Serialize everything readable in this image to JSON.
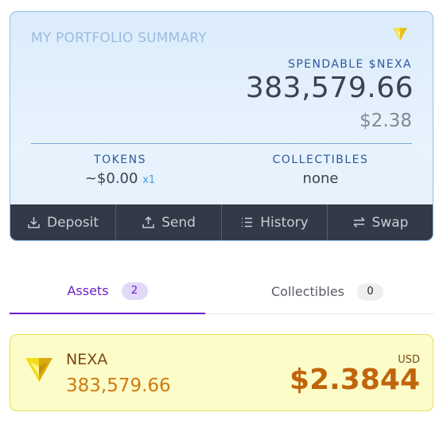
{
  "summary": {
    "title": "MY PORTFOLIO SUMMARY",
    "spendable_label": "SPENDABLE $NEXA",
    "spendable_amount": "383,579.66",
    "spendable_usd": "$2.38",
    "tokens_label": "TOKENS",
    "tokens_value": "~$0.00",
    "tokens_count": "x1",
    "collectibles_label": "COLLECTIBLES",
    "collectibles_value": "none"
  },
  "actions": [
    {
      "label": "Deposit",
      "icon": "download-icon"
    },
    {
      "label": "Send",
      "icon": "upload-icon"
    },
    {
      "label": "History",
      "icon": "list-icon"
    },
    {
      "label": "Swap",
      "icon": "swap-icon"
    }
  ],
  "tabs": {
    "assets": {
      "label": "Assets",
      "count": "2",
      "active": true
    },
    "collectibles": {
      "label": "Collectibles",
      "count": "0",
      "active": false
    }
  },
  "asset": {
    "name": "NEXA",
    "amount": "383,579.66",
    "currency": "USD",
    "value": "$2.3844",
    "icon": "nexa-logo-icon"
  },
  "colors": {
    "accent_purple": "#6a1fc7",
    "action_bar": "#343948",
    "asset_orange": "#c0650c",
    "card_border": "#8fc1ec"
  }
}
